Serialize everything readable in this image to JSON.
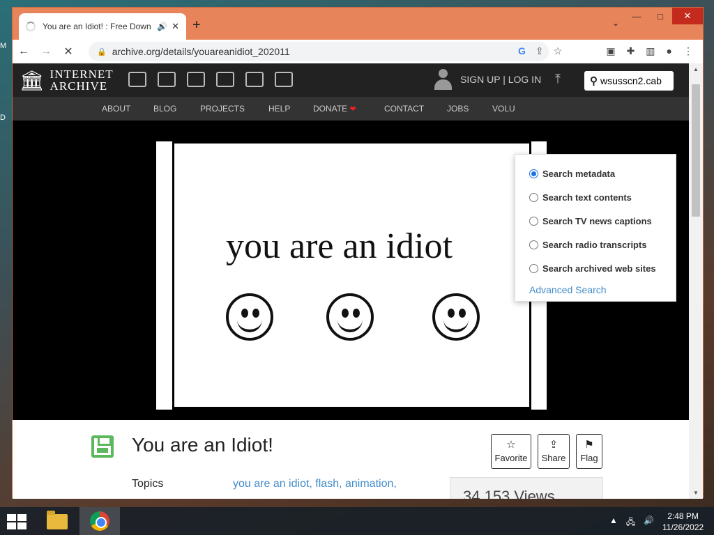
{
  "desktop": {
    "left_label_top": "M",
    "left_label_bottom": "D"
  },
  "browser": {
    "tab": {
      "title": "You are an Idiot! : Free Down",
      "audio_icon": "speaker-icon"
    },
    "window_controls": {
      "minimize": "—",
      "maximize": "□",
      "close": "✕"
    },
    "address": "archive.org/details/youareanidiot_202011"
  },
  "ia": {
    "logo_line1": "INTERNET",
    "logo_line2": "ARCHIVE",
    "signup_login": "SIGN UP | LOG IN",
    "search_value": "wsusscn2.cab",
    "nav": [
      "ABOUT",
      "BLOG",
      "PROJECTS",
      "HELP",
      "DONATE",
      "CONTACT",
      "JOBS",
      "VOLU"
    ],
    "search_options": [
      {
        "label": "Search metadata",
        "checked": true
      },
      {
        "label": "Search text contents",
        "checked": false
      },
      {
        "label": "Search TV news captions",
        "checked": false
      },
      {
        "label": "Search radio transcripts",
        "checked": false
      },
      {
        "label": "Search archived web sites",
        "checked": false
      }
    ],
    "advanced_search": "Advanced Search"
  },
  "media": {
    "text": "you are an idiot"
  },
  "item": {
    "title": "You are an Idiot!",
    "buttons": {
      "favorite": "Favorite",
      "share": "Share",
      "flag": "Flag"
    },
    "topics_label": "Topics",
    "topics_value": "you are an idiot, flash, animation,",
    "views": "34,153 Views"
  },
  "taskbar": {
    "time": "2:48 PM",
    "date": "11/26/2022"
  },
  "colors": {
    "accent_link": "#428bca",
    "window_frame": "#e8845a",
    "ia_dark": "#222222",
    "item_green": "#5cb85c"
  }
}
